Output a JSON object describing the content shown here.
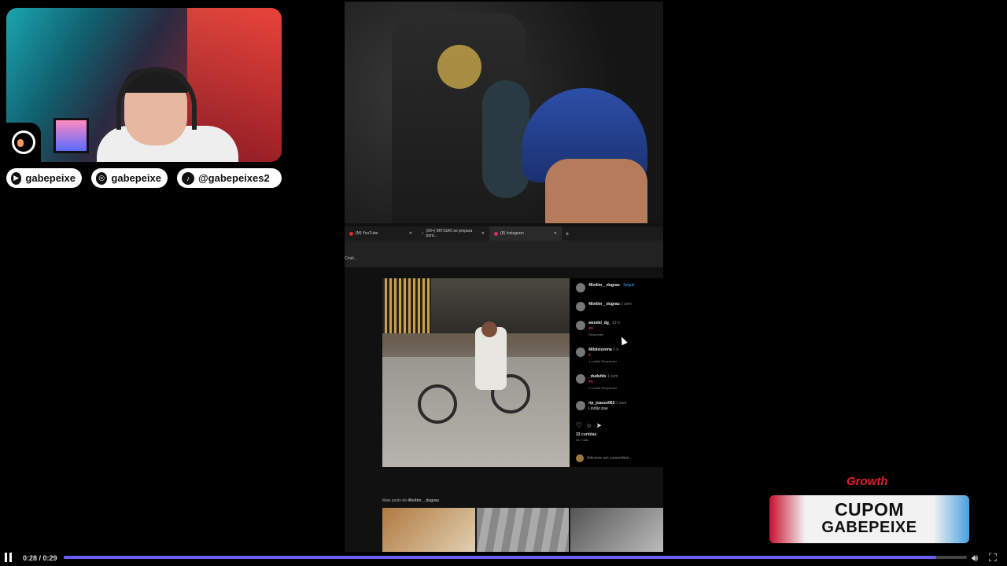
{
  "webcam": {
    "socials": [
      {
        "icon": "youtube-icon",
        "handle": "gabepeixe"
      },
      {
        "icon": "instagram-icon",
        "handle": "gabepeixe"
      },
      {
        "icon": "tiktok-icon",
        "handle": "@gabepeixes2"
      }
    ]
  },
  "browser": {
    "tabs": [
      {
        "title": "(M) YouTube"
      },
      {
        "title": "(99+) MITSUKI se prepara para..."
      },
      {
        "title": "(8) Instagram"
      }
    ],
    "bookmark": "Criati...",
    "post": {
      "author": "46vitim__dugrau",
      "follow": "Seguir",
      "comments": [
        {
          "user": "46vitim__dugrau",
          "time": "1 sem",
          "text": "",
          "reply": ""
        },
        {
          "user": "wendel_dg_",
          "time": "13 h",
          "text": "",
          "reply": "Responder"
        },
        {
          "user": "46biielzenna",
          "time": "5 d",
          "text": "",
          "reply": "1 curtida   Responder"
        },
        {
          "user": "_dudufds",
          "time": "1 sem",
          "text": "",
          "reply": "1 curtida   Responder"
        },
        {
          "user": "rip_joaozo062",
          "time": "1 sem",
          "text": "Lindão pae",
          "reply": ""
        }
      ],
      "likes": "33 curtidas",
      "ago": "há 7 dias",
      "comment_placeholder": "Adicione um comentário...",
      "more_posts_label": "Mais posts de",
      "more_posts_user": "46vitim__dugrau"
    }
  },
  "sponsor": {
    "brand": "Growth",
    "line1": "CUPOM",
    "line2": "GABEPEIXE"
  },
  "player": {
    "time": "0:28 / 0:29",
    "progress_fraction": 0.966
  }
}
